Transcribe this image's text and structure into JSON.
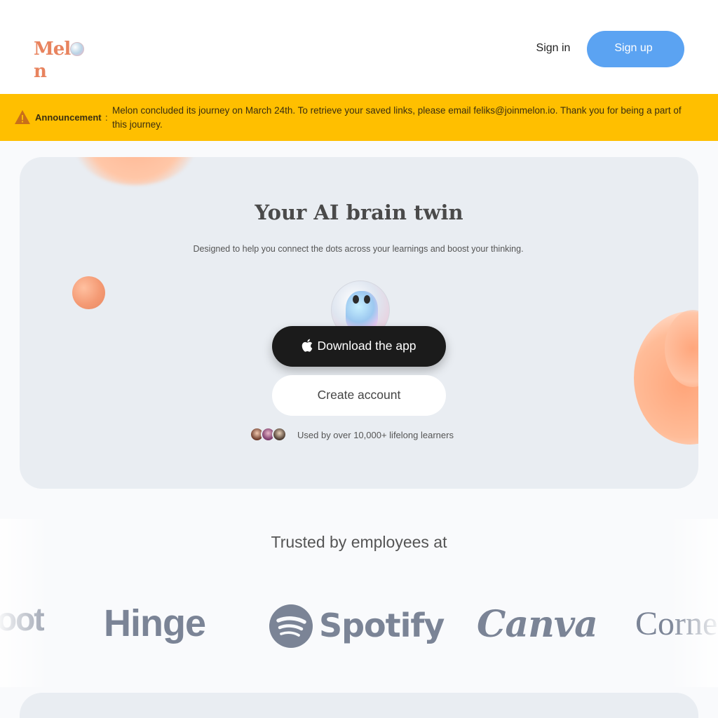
{
  "header": {
    "logo_text": "Melon",
    "signin_label": "Sign in",
    "signup_label": "Sign up"
  },
  "banner": {
    "label": "Announcement",
    "colon": ":",
    "message": "Melon concluded its journey on March 24th. To retrieve your saved links, please email feliks@joinmelon.io. Thank you for being a part of this journey.",
    "icon": "warning-icon"
  },
  "hero": {
    "title": "Your AI brain twin",
    "subtitle": "Designed to help you connect the dots across your learnings and boost your thinking.",
    "download_label": "Download the app",
    "download_icon": "apple-icon",
    "create_label": "Create account",
    "social_proof": "Used by over 10,000+ lifelong learners"
  },
  "trusted": {
    "heading": "Trusted by employees at",
    "logos": [
      "HubSpot",
      "Hinge",
      "Spotify",
      "Canva",
      "Cornell"
    ],
    "logo_texts": {
      "hubspot": "oot",
      "hinge": "Hinge",
      "spotify": "Spotify",
      "canva": "Canva",
      "cornell": "Corne"
    }
  },
  "colors": {
    "accent": "#5ba3f2",
    "banner": "#ffbf00",
    "hero_bg": "#e9edf2",
    "dark_button": "#1b1b1b"
  }
}
